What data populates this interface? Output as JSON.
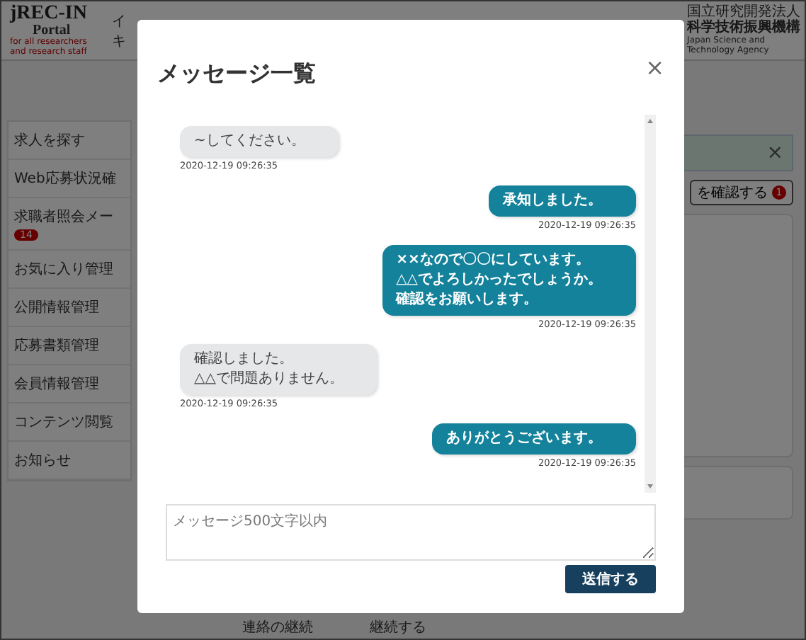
{
  "header": {
    "logo_text": "jREC-IN",
    "logo_subtext": "Portal",
    "logo_tagline": "for all researchers and research staff",
    "header_text_lines": [
      "イ",
      "キ"
    ],
    "org_small": "国立研究開発法人",
    "org_name": "科学技術振興機構",
    "org_english": "Japan Science and Technology Agency"
  },
  "sidebar": {
    "items": [
      {
        "label": "求人を探す"
      },
      {
        "label": "Web応募状況確"
      },
      {
        "label": "求職者照会メー",
        "badge": "14"
      },
      {
        "label": "お気に入り管理"
      },
      {
        "label": "公開情報管理"
      },
      {
        "label": "応募書類管理"
      },
      {
        "label": "会員情報管理"
      },
      {
        "label": "コンテンツ閲覧"
      },
      {
        "label": "お知らせ"
      }
    ]
  },
  "main": {
    "alert_close": "×",
    "message_button": {
      "label": "を確認する",
      "badge": "1"
    },
    "footer_row": {
      "label": "連絡の継続",
      "value": "継続する"
    }
  },
  "modal": {
    "title": "メッセージ一覧",
    "close": "×",
    "messages": [
      {
        "kind": "received",
        "lines": [
          "~してください。"
        ],
        "time": "2020-12-19 09:26:35"
      },
      {
        "kind": "sent",
        "lines": [
          "承知しました。"
        ],
        "time": "2020-12-19 09:26:35"
      },
      {
        "kind": "sent",
        "lines": [
          "××なので〇〇にしています。",
          "△△でよろしかったでしょうか。",
          "確認をお願いします。"
        ],
        "time": "2020-12-19 09:26:35"
      },
      {
        "kind": "received",
        "lines": [
          "確認しました。",
          "△△で問題ありません。"
        ],
        "time": "2020-12-19 09:26:35"
      },
      {
        "kind": "sent",
        "lines": [
          "ありがとうございます。"
        ],
        "time": "2020-12-19 09:26:35"
      }
    ],
    "input": {
      "placeholder": "メッセージ500文字以内"
    },
    "send_button": "送信する"
  }
}
